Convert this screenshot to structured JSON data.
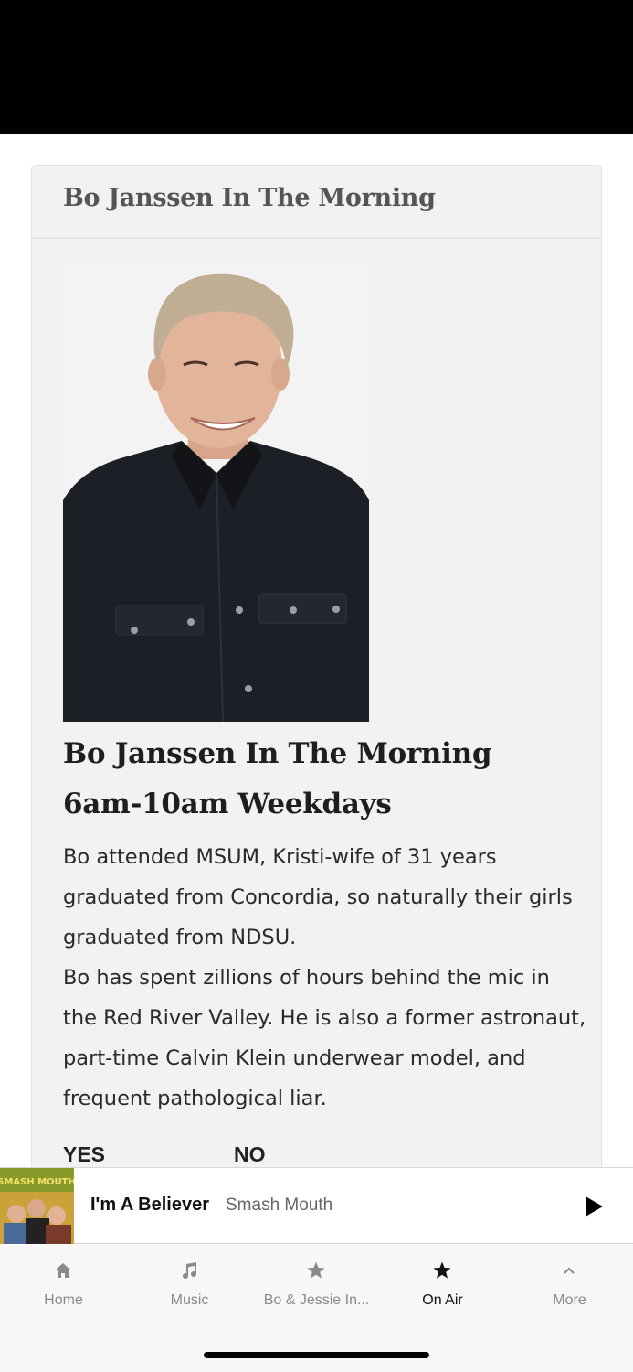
{
  "card": {
    "header_title": "Bo Janssen In The Morning"
  },
  "show": {
    "title_line1": "Bo Janssen In The Morning",
    "title_line2": "6am-10am Weekdays",
    "bio_p1": "Bo attended MSUM, Kristi-wife of 31 years graduated from Concordia, so naturally their girls graduated from NDSU.",
    "bio_p2": "Bo has spent zillions of hours behind the mic in the Red River Valley. He is also a former astronaut, part-time Calvin Klein underwear model, and frequent pathological liar."
  },
  "poll": {
    "yes_label": "YES",
    "no_label": "NO"
  },
  "now_playing": {
    "title": "I'm A Believer",
    "artist": "Smash Mouth",
    "album_text": "SMASH MOUTH",
    "play_icon": "play-icon"
  },
  "tabs": [
    {
      "label": "Home",
      "icon": "home-icon",
      "active": false
    },
    {
      "label": "Music",
      "icon": "music-note-icon",
      "active": false
    },
    {
      "label": "Bo & Jessie In...",
      "icon": "star-icon",
      "active": false
    },
    {
      "label": "On Air",
      "icon": "star-icon",
      "active": true
    },
    {
      "label": "More",
      "icon": "chevron-up-icon",
      "active": false
    }
  ],
  "colors": {
    "status_bar": "#000000",
    "card_bg": "#f2f2f2",
    "tab_inactive": "#8a8a8a",
    "tab_active": "#111111"
  }
}
